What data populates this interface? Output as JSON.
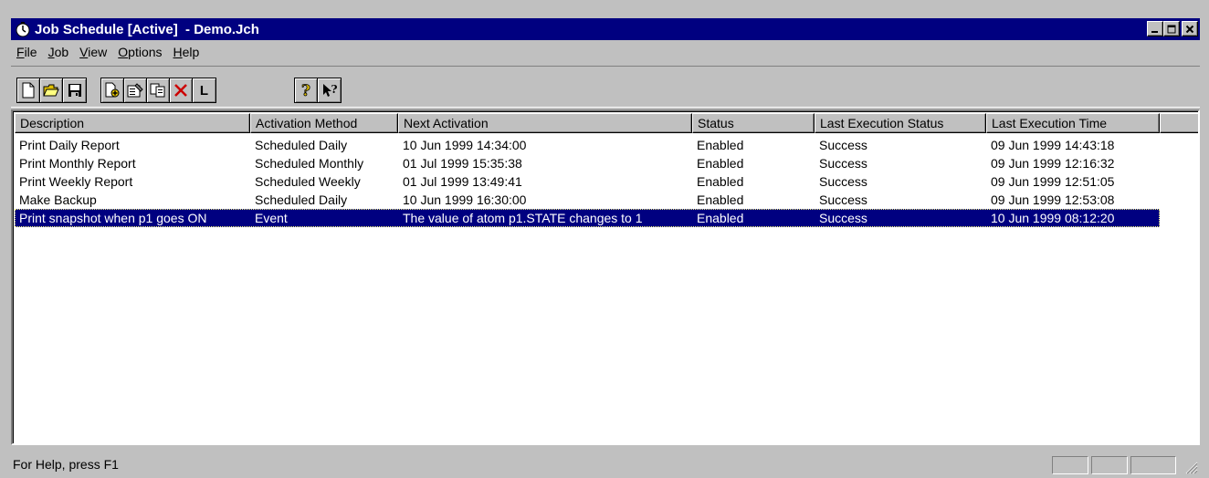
{
  "window": {
    "title": "Job Schedule [Active]  - Demo.Jch",
    "icon": "stopwatch-icon",
    "controls": {
      "minimize": "_",
      "maximize": "□",
      "close": "×"
    }
  },
  "menu": {
    "items": [
      {
        "label": "File",
        "accel": "F",
        "rest": "ile"
      },
      {
        "label": "Job",
        "accel": "J",
        "rest": "ob"
      },
      {
        "label": "View",
        "accel": "V",
        "rest": "iew"
      },
      {
        "label": "Options",
        "accel": "O",
        "rest": "ptions"
      },
      {
        "label": "Help",
        "accel": "H",
        "rest": "elp"
      }
    ]
  },
  "toolbar": {
    "buttons": [
      "new-file-icon",
      "open-folder-icon",
      "save-disk-icon",
      "new-job-icon",
      "job-properties-icon",
      "copy-icon",
      "delete-icon",
      "log-icon",
      "help-icon",
      "context-help-icon"
    ],
    "log_label": "L"
  },
  "list": {
    "columns": [
      "Description",
      "Activation Method",
      "Next Activation",
      "Status",
      "Last Execution Status",
      "Last Execution Time"
    ],
    "rows": [
      [
        "Print Daily Report",
        "Scheduled Daily",
        "10 Jun 1999 14:34:00",
        "Enabled",
        "Success",
        "09 Jun 1999 14:43:18"
      ],
      [
        "Print Monthly Report",
        "Scheduled Monthly",
        "01 Jul 1999 15:35:38",
        "Enabled",
        "Success",
        "09 Jun 1999 12:16:32"
      ],
      [
        "Print Weekly Report",
        "Scheduled Weekly",
        "01 Jul 1999 13:49:41",
        "Enabled",
        "Success",
        "09 Jun 1999 12:51:05"
      ],
      [
        "Make Backup",
        "Scheduled Daily",
        "10 Jun 1999 16:30:00",
        "Enabled",
        "Success",
        "09 Jun 1999 12:53:08"
      ],
      [
        "Print snapshot when p1 goes ON",
        "Event",
        "The value of atom p1.STATE changes to 1",
        "Enabled",
        "Success",
        "10 Jun 1999 08:12:20"
      ]
    ],
    "selected_row": 4
  },
  "status": {
    "text": "For Help, press F1"
  },
  "colors": {
    "titlebar": "#000080",
    "face": "#c0c0c0",
    "selection": "#000080",
    "delete_icon": "#cc0000"
  }
}
